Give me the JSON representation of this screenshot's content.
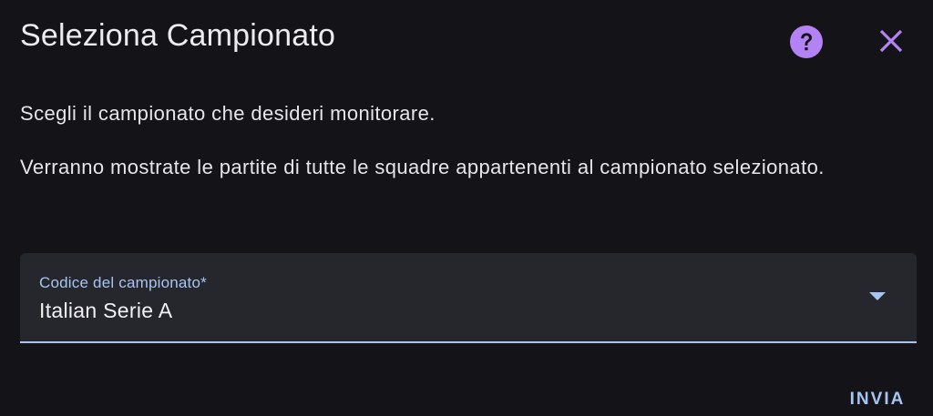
{
  "dialog": {
    "title": "Seleziona Campionato",
    "help_icon": "help-circle-icon",
    "close_icon": "close-icon",
    "paragraphs": [
      "Scegli il campionato che desideri monitorare.",
      "Verranno mostrate le partite di tutte le squadre appartenenti al campionato selezionato."
    ],
    "select": {
      "label": "Codice del campionato*",
      "value": "Italian Serie A"
    },
    "submit_label": "INVIA"
  },
  "colors": {
    "background": "#141418",
    "accent_purple": "#b383f5",
    "accent_blue": "#a8c4f4",
    "field_bg": "#25272c"
  }
}
